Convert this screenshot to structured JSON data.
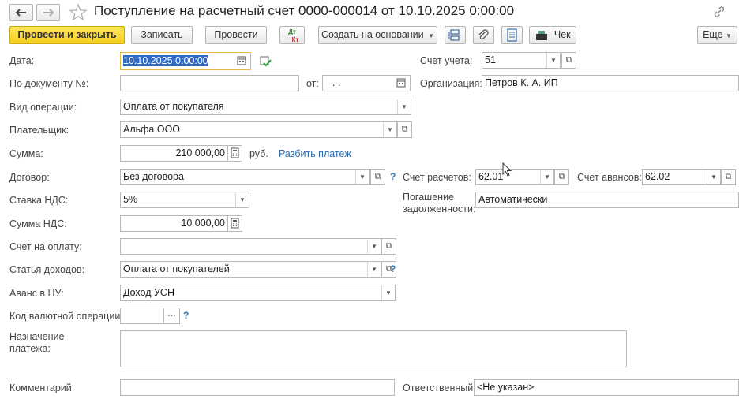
{
  "title": "Поступление на расчетный счет 0000-000014 от 10.10.2025 0:00:00",
  "toolbar": {
    "post_close": "Провести и закрыть",
    "save": "Записать",
    "post": "Провести",
    "dtkt_top": "Дт",
    "dtkt_bottom": "Кт",
    "create_based": "Создать на основании",
    "check": "Чек",
    "more": "Еще"
  },
  "form": {
    "date_label": "Дата:",
    "date_value": "10.10.2025  0:00:00",
    "doc_no_label": "По документу №:",
    "doc_no_value": "",
    "from_label": "от:",
    "from_value": ". .",
    "account_label": "Счет учета:",
    "account_value": "51",
    "org_label": "Организация:",
    "org_value": "Петров К. А. ИП",
    "op_type_label": "Вид операции:",
    "op_type_value": "Оплата от покупателя",
    "payer_label": "Плательщик:",
    "payer_value": "Альфа ООО",
    "sum_label": "Сумма:",
    "sum_value": "210 000,00",
    "currency": "руб.",
    "split_link": "Разбить платеж",
    "contract_label": "Договор:",
    "contract_value": "Без договора",
    "settle_acc_label": "Счет расчетов:",
    "settle_acc_value": "62.01",
    "adv_acc_label": "Счет авансов:",
    "adv_acc_value": "62.02",
    "vat_rate_label": "Ставка НДС:",
    "vat_rate_value": "5%",
    "repay_label_1": "Погашение",
    "repay_label_2": "задолженности:",
    "repay_value": "Автоматически",
    "vat_sum_label": "Сумма НДС:",
    "vat_sum_value": "10 000,00",
    "invoice_label": "Счет на оплату:",
    "invoice_value": "",
    "income_label": "Статья доходов:",
    "income_value": "Оплата от покупателей",
    "advance_label": "Аванс в НУ:",
    "advance_value": "Доход УСН",
    "currency_op_label": "Код валютной операции:",
    "currency_op_value": "",
    "purpose_label_1": "Назначение",
    "purpose_label_2": "платежа:",
    "purpose_value": "",
    "comment_label": "Комментарий:",
    "comment_value": "",
    "responsible_label": "Ответственный:",
    "responsible_value": "<Не указан>"
  },
  "colors": {
    "accent_yellow": "#f5cf1f",
    "link_blue": "#2b69b0",
    "highlight": "#316ac5"
  }
}
